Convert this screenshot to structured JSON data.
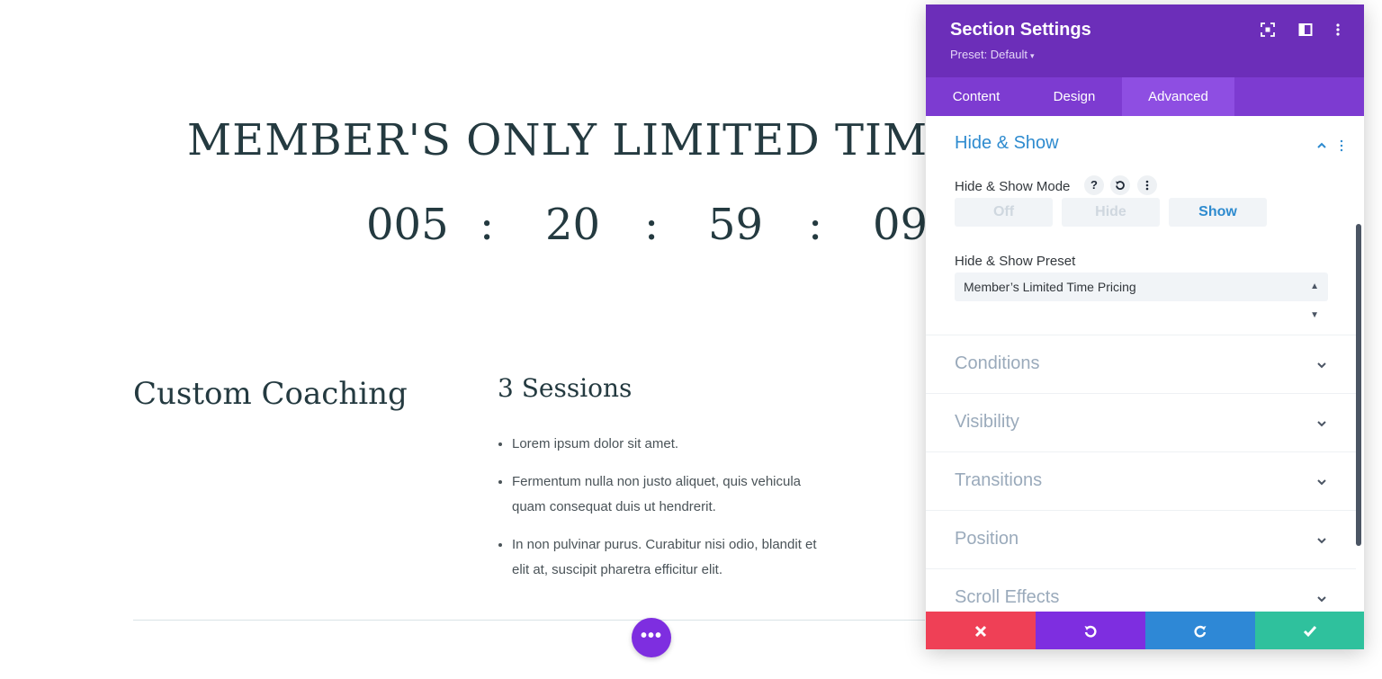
{
  "page": {
    "headline": "MEMBER'S ONLY LIMITED TIME",
    "countdown": {
      "days": "005",
      "hours": "20",
      "minutes": "59",
      "seconds": "09",
      "separator": ":"
    },
    "coach_title": "Custom Coaching",
    "sessions_title": "3 Sessions",
    "features": [
      "Lorem ipsum dolor sit amet.",
      "Fermentum nulla non justo aliquet, quis vehicula quam consequat duis ut hendrerit.",
      "In non pulvinar purus. Curabitur nisi odio, blandit et elit at, suscipit pharetra efficitur elit."
    ],
    "fab_label": "•••"
  },
  "modal": {
    "title": "Section Settings",
    "preset": "Preset: Default",
    "tabs": [
      {
        "label": "Content"
      },
      {
        "label": "Design"
      },
      {
        "label": "Advanced",
        "active": true
      }
    ],
    "hide_show": {
      "title": "Hide & Show",
      "mode_label": "Hide & Show Mode",
      "help_icon": "?",
      "mode_options": [
        "Off",
        "Hide",
        "Show"
      ],
      "mode_selected": "Show",
      "preset_label": "Hide & Show Preset",
      "preset_value": "Member’s Limited Time Pricing"
    },
    "groups": [
      "Conditions",
      "Visibility",
      "Transitions",
      "Position",
      "Scroll Effects"
    ]
  },
  "colors": {
    "header": "#6c2eb9",
    "tabs": "#7d3bd1",
    "active_tab": "#8e4ee2",
    "accent_blue": "#2e8bcf",
    "cancel": "#ef4056",
    "undo": "#7e2ee0",
    "redo": "#2e88d6",
    "save": "#2fc19d"
  }
}
